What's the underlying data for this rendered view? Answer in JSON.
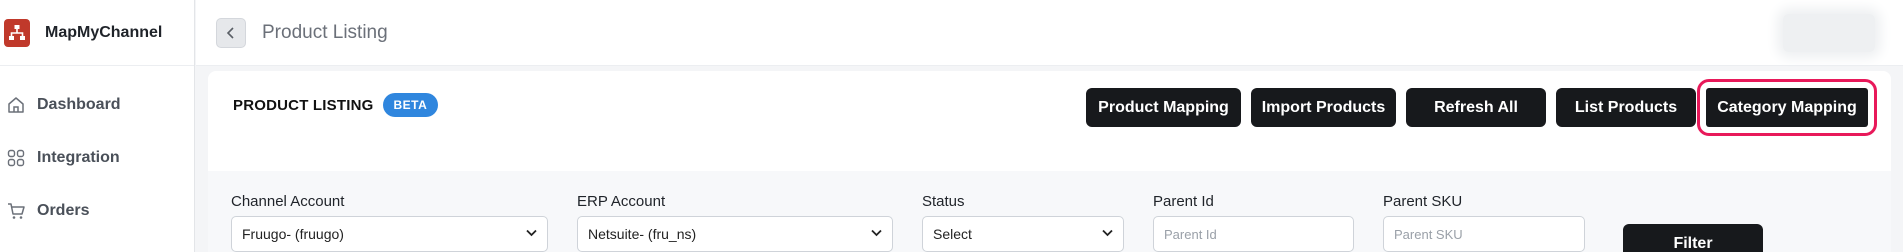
{
  "brand": {
    "name": "MapMyChannel"
  },
  "sidebar": {
    "items": [
      {
        "label": "Dashboard",
        "icon": "home-icon"
      },
      {
        "label": "Integration",
        "icon": "grid-icon"
      },
      {
        "label": "Orders",
        "icon": "cart-icon"
      }
    ]
  },
  "topbar": {
    "title": "Product Listing"
  },
  "main": {
    "heading": "PRODUCT LISTING",
    "badge": "BETA",
    "actions": {
      "product_mapping": "Product Mapping",
      "import_products": "Import Products",
      "refresh_all": "Refresh All",
      "list_products": "List Products",
      "category_mapping": "Category Mapping"
    },
    "filters": {
      "channel_account": {
        "label": "Channel Account",
        "value": "Fruugo- (fruugo)"
      },
      "erp_account": {
        "label": "ERP Account",
        "value": "Netsuite- (fru_ns)"
      },
      "status": {
        "label": "Status",
        "value": "Select"
      },
      "parent_id": {
        "label": "Parent Id",
        "placeholder": "Parent Id"
      },
      "parent_sku": {
        "label": "Parent SKU",
        "placeholder": "Parent SKU"
      },
      "filter_label": "Filter"
    }
  },
  "colors": {
    "accent": "#2f86de",
    "highlight": "#e8195a",
    "brand": "#c0392b",
    "button": "#17191c"
  }
}
